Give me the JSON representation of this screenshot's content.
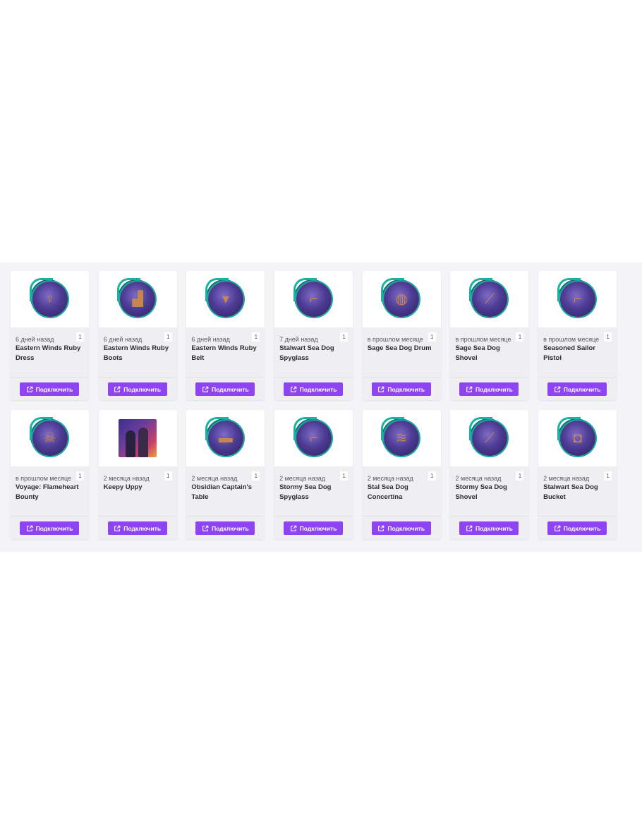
{
  "button_label": "Подключить",
  "accent_color": "#8e44f2",
  "cards": [
    {
      "time": "6 дней назад",
      "count": "1",
      "title": "Eastern Winds Ruby Dress",
      "icon": "dress-icon",
      "glyph": "♀"
    },
    {
      "time": "6 дней назад",
      "count": "1",
      "title": "Eastern Winds Ruby Boots",
      "icon": "boots-icon",
      "glyph": "▟"
    },
    {
      "time": "6 дней назад",
      "count": "1",
      "title": "Eastern Winds Ruby Belt",
      "icon": "belt-icon",
      "glyph": "▾"
    },
    {
      "time": "7 дней назад",
      "count": "1",
      "title": "Stalwart Sea Dog Spyglass",
      "icon": "spyglass-icon",
      "glyph": "⌐"
    },
    {
      "time": "в прошлом месяце",
      "count": "1",
      "title": "Sage Sea Dog Drum",
      "icon": "drum-icon",
      "glyph": "◍"
    },
    {
      "time": "в прошлом месяце",
      "count": "1",
      "title": "Sage Sea Dog Shovel",
      "icon": "shovel-icon",
      "glyph": "⟋"
    },
    {
      "time": "в прошлом месяце",
      "count": "1",
      "title": "Seasoned Sailor Pistol",
      "icon": "pistol-icon",
      "glyph": "⌐"
    },
    {
      "time": "в прошлом месяце",
      "count": "1",
      "title": "Voyage: Flameheart Bounty",
      "icon": "bounty-icon",
      "glyph": "☠"
    },
    {
      "time": "2 месяца назад",
      "count": "1",
      "title": "Keepy Uppy",
      "icon": "emote-poster",
      "glyph": ""
    },
    {
      "time": "2 месяца назад",
      "count": "1",
      "title": "Obsidian Captain's Table",
      "icon": "table-icon",
      "glyph": "▬"
    },
    {
      "time": "2 месяца назад",
      "count": "1",
      "title": "Stormy Sea Dog Spyglass",
      "icon": "spyglass-icon",
      "glyph": "⌐"
    },
    {
      "time": "2 месяца назад",
      "count": "1",
      "title": "Stal Sea Dog Concertina",
      "icon": "concertina-icon",
      "glyph": "≋"
    },
    {
      "time": "2 месяца назад",
      "count": "1",
      "title": "Stormy Sea Dog Shovel",
      "icon": "shovel-icon",
      "glyph": "⟋"
    },
    {
      "time": "2 месяца назад",
      "count": "1",
      "title": "Stalwart Sea Dog Bucket",
      "icon": "bucket-icon",
      "glyph": "◘"
    }
  ]
}
